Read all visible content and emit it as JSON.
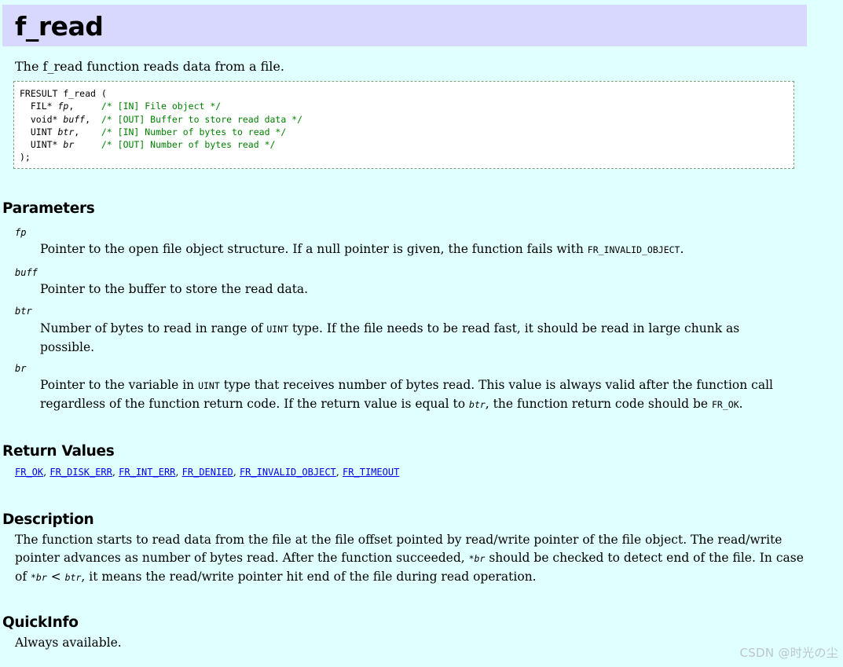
{
  "page": {
    "title": "f_read",
    "lead": "The f_read function reads data from a file."
  },
  "prototype": {
    "line1": "FRESULT f_read (",
    "params": [
      {
        "type": "  FIL* ",
        "name": "fp",
        "after": ",     ",
        "comment": "/* [IN] File object */"
      },
      {
        "type": "  void* ",
        "name": "buff",
        "after": ",  ",
        "comment": "/* [OUT] Buffer to store read data */"
      },
      {
        "type": "  UINT ",
        "name": "btr",
        "after": ",    ",
        "comment": "/* [IN] Number of bytes to read */"
      },
      {
        "type": "  UINT* ",
        "name": "br",
        "after": "     ",
        "comment": "/* [OUT] Number of bytes read */"
      }
    ],
    "close": ");"
  },
  "parameters": {
    "heading": "Parameters",
    "fp": {
      "term": "fp",
      "text1": "Pointer to the open file object structure. If a null pointer is given, the function fails with ",
      "code1": "FR_INVALID_OBJECT",
      "text2": "."
    },
    "buff": {
      "term": "buff",
      "text1": "Pointer to the buffer to store the read data."
    },
    "btr": {
      "term": "btr",
      "text1": "Number of bytes to read in range of ",
      "code1": "UINT",
      "text2": " type. If the file needs to be read fast, it should be read in large chunk as possible."
    },
    "br": {
      "term": "br",
      "text1": "Pointer to the variable in ",
      "code1": "UINT",
      "text2": " type that receives number of bytes read. This value is always valid after the function call regardless of the function return code. If the return value is equal to ",
      "code2": "btr",
      "text3": ", the function return code should be ",
      "code3": "FR_OK",
      "text4": "."
    }
  },
  "return_values": {
    "heading": "Return Values",
    "links": [
      "FR_OK",
      "FR_DISK_ERR",
      "FR_INT_ERR",
      "FR_DENIED",
      "FR_INVALID_OBJECT",
      "FR_TIMEOUT"
    ],
    "separator": ", "
  },
  "description": {
    "heading": "Description",
    "text1": "The function starts to read data from the file at the file offset pointed by read/write pointer of the file object. The read/write pointer advances as number of bytes read. After the function succeeded, ",
    "code1": "*br",
    "text2": " should be checked to detect end of the file. In case of ",
    "code2": "*br",
    "text3": " < ",
    "code3": "btr",
    "text4": ", it means the read/write pointer hit end of the file during read operation."
  },
  "quickinfo": {
    "heading": "QuickInfo",
    "text": "Always available."
  },
  "watermark": "CSDN @时光の尘"
}
